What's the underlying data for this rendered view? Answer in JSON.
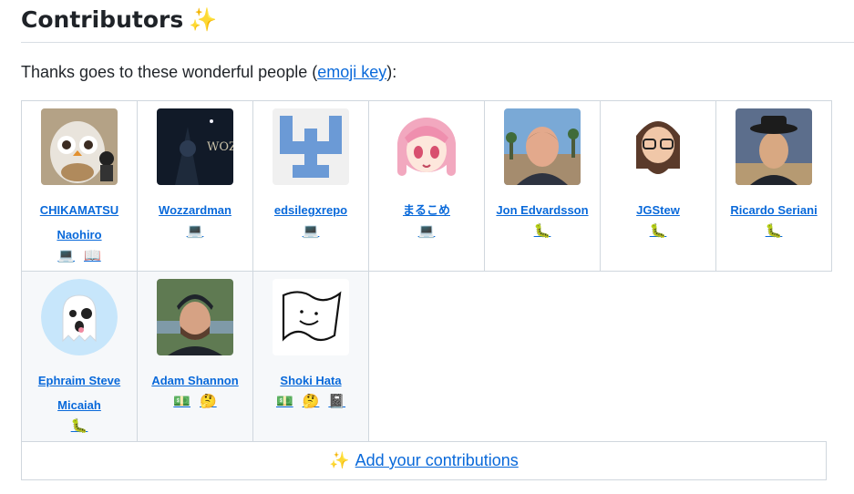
{
  "header": {
    "title": "Contributors",
    "sparkle": "✨"
  },
  "intro": {
    "prefix": "Thanks goes to these wonderful people (",
    "link": "emoji key",
    "suffix": "):"
  },
  "contributors": [
    {
      "name": "CHIKAMATSU Naohiro",
      "badges": [
        "💻",
        "📖"
      ]
    },
    {
      "name": "Wozzardman",
      "badges": [
        "💻"
      ]
    },
    {
      "name": "edsilegxrepo",
      "badges": [
        "💻"
      ]
    },
    {
      "name": "まるこめ",
      "badges": [
        "💻"
      ]
    },
    {
      "name": "Jon Edvardsson",
      "badges": [
        "🐛"
      ]
    },
    {
      "name": "JGStew",
      "badges": [
        "🐛"
      ]
    },
    {
      "name": "Ricardo Seriani",
      "badges": [
        "🐛"
      ]
    },
    {
      "name": "Ephraim Steve Micaiah",
      "badges": [
        "🐛"
      ]
    },
    {
      "name": "Adam Shannon",
      "badges": [
        "💵",
        "🤔"
      ]
    },
    {
      "name": "Shoki Hata",
      "badges": [
        "💵",
        "🤔",
        "📓"
      ]
    }
  ],
  "footer": {
    "icon": "✨",
    "link": "Add your contributions"
  }
}
